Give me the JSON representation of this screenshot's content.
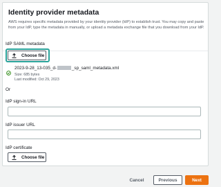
{
  "section": {
    "title": "Identity provider metadata",
    "description": "AWS requires specific metadata provided by your identity provider (IdP) to establish trust. You may copy and paste from your IdP, type the metadata in manually, or upload a metadata exchange file that you download from your IdP."
  },
  "saml_metadata": {
    "label": "IdP SAML metadata",
    "choose_file_label": "Choose file",
    "file": {
      "name_prefix": "2023-9-28_13-035_d-",
      "name_suffix": "_sp_saml_metadata.xml",
      "size": "Size: 685 bytes",
      "modified": "Last modified: Oct 29, 2023"
    }
  },
  "or_text": "Or",
  "sign_in_url": {
    "label": "IdP sign-in URL",
    "value": ""
  },
  "issuer_url": {
    "label": "IdP issuer URL",
    "value": ""
  },
  "certificate": {
    "label": "IdP certificate",
    "choose_file_label": "Choose file"
  },
  "footer": {
    "cancel_label": "Cancel",
    "previous_label": "Previous",
    "next_label": "Next"
  },
  "colors": {
    "primary": "#ec7211",
    "success": "#1d8102",
    "focus": "#2aa39a"
  },
  "icons": {
    "upload": "upload-icon",
    "success": "check-circle-icon"
  }
}
